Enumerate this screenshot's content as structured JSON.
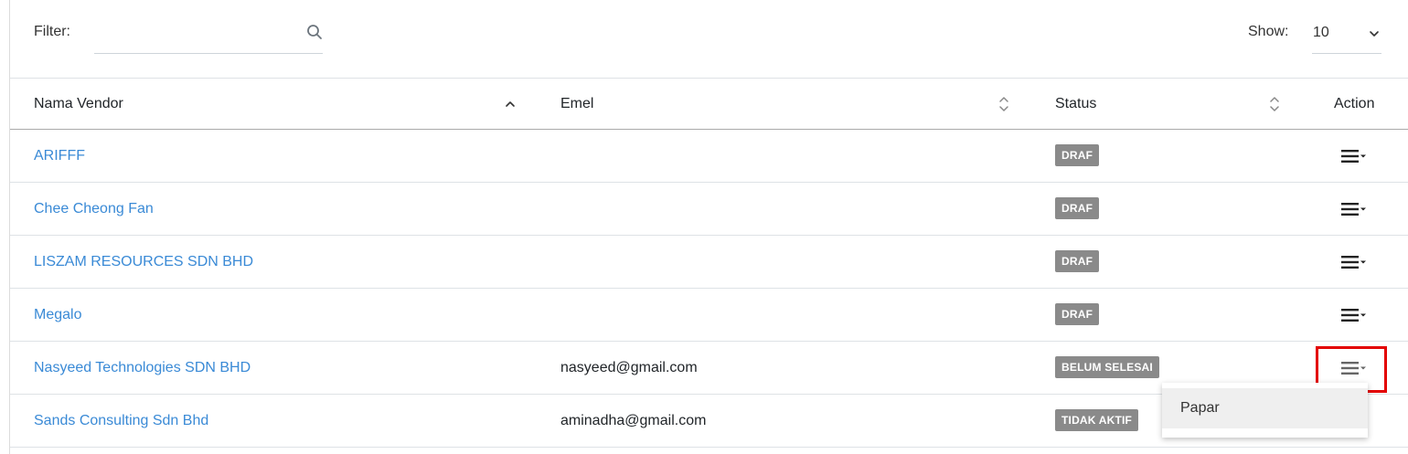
{
  "toolbar": {
    "filter_label": "Filter:",
    "filter_value": "",
    "show_label": "Show:",
    "show_value": "10"
  },
  "table": {
    "columns": [
      "Nama Vendor",
      "Emel",
      "Status",
      "Action"
    ],
    "sort": {
      "column": "Nama Vendor",
      "direction": "asc"
    },
    "rows": [
      {
        "name": "ARIFFF",
        "email": "",
        "status": "DRAF"
      },
      {
        "name": "Chee Cheong Fan",
        "email": "",
        "status": "DRAF"
      },
      {
        "name": "LISZAM RESOURCES SDN BHD",
        "email": "",
        "status": "DRAF"
      },
      {
        "name": "Megalo",
        "email": "",
        "status": "DRAF"
      },
      {
        "name": "Nasyeed Technologies SDN BHD",
        "email": "nasyeed@gmail.com",
        "status": "BELUM SELESAI"
      },
      {
        "name": "Sands Consulting Sdn Bhd",
        "email": "aminadha@gmail.com",
        "status": "TIDAK AKTIF"
      }
    ]
  },
  "action_menu": {
    "open_row": 4,
    "items": [
      "Papar"
    ]
  },
  "icons": {
    "search": "search-icon",
    "show_dropdown": "chevron-down-icon",
    "sort_asc": "sort-asc-icon",
    "sort_both": "sort-icon",
    "row_action": "hamburger-menu-icon"
  },
  "colors": {
    "link": "#3a8ad6",
    "badge": "#8a8a8a",
    "highlight": "#e30000"
  }
}
